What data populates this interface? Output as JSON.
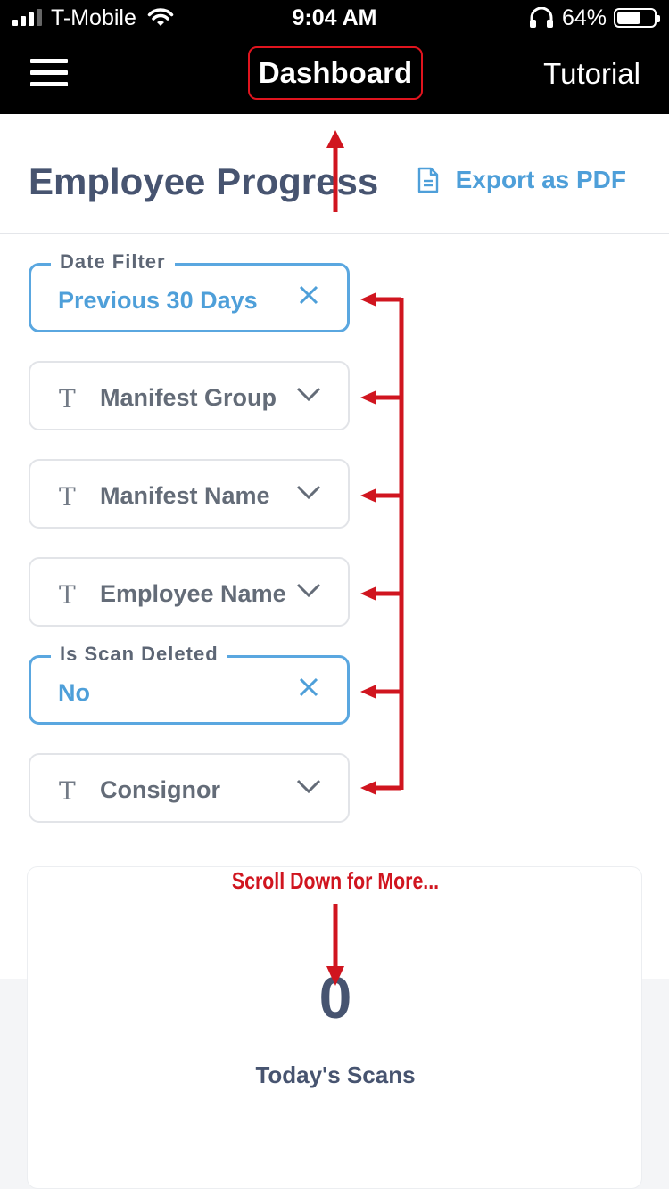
{
  "status_bar": {
    "carrier": "T-Mobile",
    "time": "9:04 AM",
    "battery_percent": "64%",
    "battery_level": 0.64,
    "icons": [
      "signal-icon",
      "wifi-icon",
      "headphones-icon",
      "battery-icon"
    ]
  },
  "nav": {
    "title": "Dashboard",
    "tutorial": "Tutorial",
    "menu_icon": "hamburger-menu-icon"
  },
  "header": {
    "title": "Employee Progress",
    "export_label": "Export as PDF",
    "export_icon": "document-icon"
  },
  "filters": [
    {
      "legend": "Date Filter",
      "value": "Previous 30 Days",
      "state": "selected"
    },
    {
      "label": "Manifest Group",
      "state": "empty"
    },
    {
      "label": "Manifest Name",
      "state": "empty"
    },
    {
      "label": "Employee Name",
      "state": "empty"
    },
    {
      "legend": "Is Scan Deleted",
      "value": "No",
      "state": "selected"
    },
    {
      "label": "Consignor",
      "state": "empty"
    }
  ],
  "field_type_glyph": "T",
  "annotation": {
    "scroll_note": "Scroll Down for More...",
    "color": "#d0151f"
  },
  "stats": {
    "today_scans_value": "0",
    "today_scans_label": "Today's Scans"
  },
  "colors": {
    "accent": "#4e9fd9",
    "title": "#475470",
    "annotation_red": "#d0151f"
  }
}
